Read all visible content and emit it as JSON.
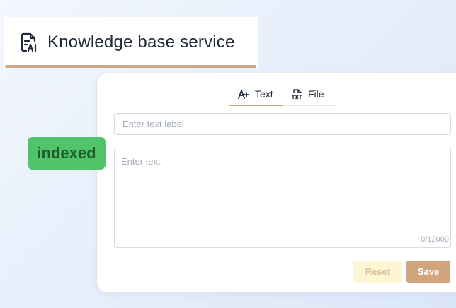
{
  "header": {
    "title": "Knowledge base service",
    "icon": "ai-document-icon"
  },
  "tabs": [
    {
      "label": "Text",
      "icon": "text-ai-icon",
      "active": true
    },
    {
      "label": "File",
      "icon": "txt-file-icon",
      "active": false
    }
  ],
  "form": {
    "label_placeholder": "Enter text label",
    "label_value": "",
    "text_placeholder": "Enter text",
    "text_value": "",
    "char_counter": "0/12000"
  },
  "badge": {
    "label": "indexed",
    "color": "#4fc46a"
  },
  "buttons": {
    "reset_label": "Reset",
    "save_label": "Save"
  },
  "colors": {
    "accent": "#c9a88a",
    "save_bg": "#d0a57d",
    "reset_bg": "#fcf6d2"
  }
}
